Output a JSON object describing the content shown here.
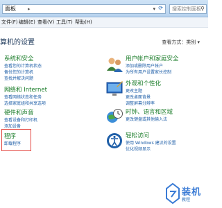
{
  "address_bar": {
    "path": "面板",
    "separator": "▸"
  },
  "search": {
    "placeholder": "搜索控制面板"
  },
  "menu": {
    "items": [
      "文件(F)",
      "编辑(E)",
      "查看(V)",
      "工具(T)",
      "帮助(H)"
    ]
  },
  "page": {
    "title": "算机的设置",
    "view_by": "查看方式：类别 ▾"
  },
  "left_categories": [
    {
      "title": "系统和安全",
      "links": [
        "查看您的计算机状态",
        "备份您的计算机",
        "查找并解决问题"
      ],
      "icon": "shield-flag-icon"
    },
    {
      "title": "网络和 Internet",
      "links": [
        "查看网络状态和任务",
        "选择家庭组和共享选项"
      ],
      "icon": "network-globe-icon"
    },
    {
      "title": "硬件和声音",
      "links": [
        "查看设备和打印机",
        "添加设备"
      ],
      "icon": "printer-speaker-icon"
    },
    {
      "title": "程序",
      "links": [
        "卸载程序"
      ],
      "icon": "programs-icon"
    }
  ],
  "right_categories": [
    {
      "title": "用户帐户和家庭安全",
      "links": [
        "添加或删除用户帐户",
        "为所有用户设置家长控制"
      ],
      "icon": "users-icon"
    },
    {
      "title": "外观和个性化",
      "links": [
        "更改主题",
        "更改桌面背景",
        "调整屏幕分辨率"
      ],
      "icon": "appearance-icon"
    },
    {
      "title": "时钟、语言和区域",
      "links": [
        "更改键盘或其他输入法"
      ],
      "icon": "clock-globe-icon"
    },
    {
      "title": "轻松访问",
      "links": [
        "使用 Windows 建议的设置",
        "优化视频显示"
      ],
      "icon": "ease-of-access-icon"
    }
  ],
  "watermark": {
    "text": "装机",
    "sub": "教程"
  },
  "colors": {
    "category_title": "#1b7d2a",
    "link": "#1f5fa8",
    "highlight_box": "#e3463f",
    "titlebar": "#c6dcf2"
  }
}
